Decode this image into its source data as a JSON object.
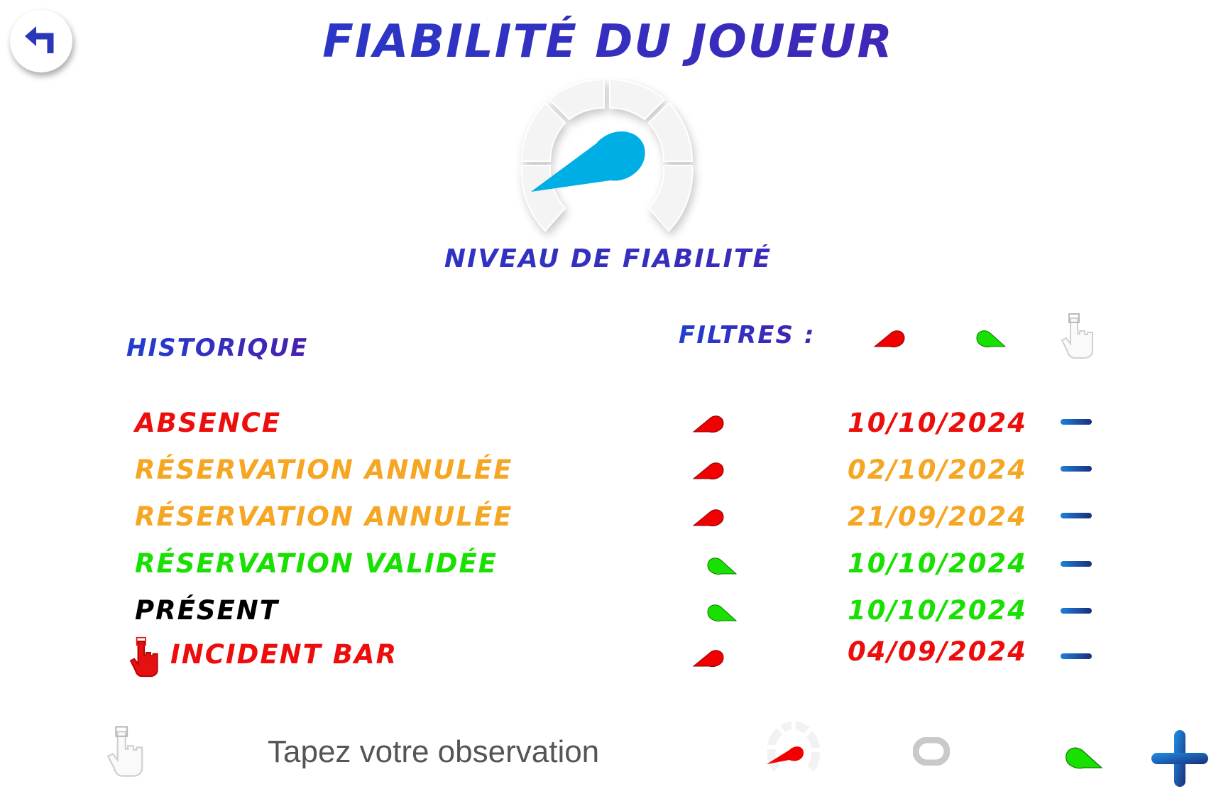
{
  "header": {
    "title": "FIABILITÉ DU JOUEUR",
    "back_icon": "return-arrow-icon"
  },
  "gauge": {
    "label": "NIVEAU DE FIABILITÉ",
    "needle_color": "#00aee6",
    "icon": "reliability-gauge-icon"
  },
  "history": {
    "title": "HISTORIQUE",
    "filters_label": "FILTRES :",
    "filters": [
      {
        "icon": "red-needle-icon",
        "color": "#f00000"
      },
      {
        "icon": "green-needle-icon",
        "color": "#18e000"
      },
      {
        "icon": "hand-pointer-icon"
      }
    ],
    "rows": [
      {
        "label": "ABSENCE",
        "date": "10/10/2024",
        "label_color": "#ee0d0d",
        "date_color": "#ee0d0d",
        "indicator": "red",
        "action_icon": "minus-icon"
      },
      {
        "label": "RÉSERVATION ANNULÉE",
        "date": "02/10/2024",
        "label_color": "#f5a623",
        "date_color": "#f5a623",
        "indicator": "red",
        "action_icon": "minus-icon"
      },
      {
        "label": "RÉSERVATION ANNULÉE",
        "date": "21/09/2024",
        "label_color": "#f5a623",
        "date_color": "#f5a623",
        "indicator": "red",
        "action_icon": "minus-icon"
      },
      {
        "label": "RÉSERVATION VALIDÉE",
        "date": "10/10/2024",
        "label_color": "#18e000",
        "date_color": "#18e000",
        "indicator": "green",
        "action_icon": "minus-icon"
      },
      {
        "label": "PRÉSENT",
        "date": "10/10/2024",
        "label_color": "#000000",
        "date_color": "#18e000",
        "indicator": "green",
        "action_icon": "minus-icon"
      },
      {
        "label": "INCIDENT BAR",
        "date": "04/09/2024",
        "label_color": "#ee0d0d",
        "date_color": "#ee0d0d",
        "indicator": "red",
        "action_icon": "minus-icon",
        "leading_icon": "red-hand-pointer-icon"
      }
    ]
  },
  "observation": {
    "placeholder": "Tapez votre observation",
    "hand_icon": "hand-pointer-icon",
    "mode_icons": [
      "red-gauge-icon",
      "neutral-zero-icon",
      "green-needle-icon"
    ],
    "add_icon": "plus-icon"
  },
  "colors": {
    "title_start": "#1f3fcf",
    "title_end": "#4a1fae",
    "red": "#f00000",
    "orange": "#f5a623",
    "green": "#18e000",
    "blue_accent": "#00aee6"
  }
}
